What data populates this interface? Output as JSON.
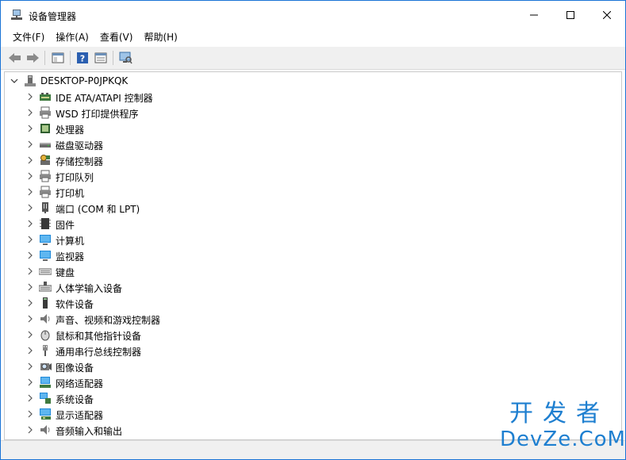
{
  "window": {
    "title": "设备管理器"
  },
  "menu": [
    {
      "label": "文件(F)"
    },
    {
      "label": "操作(A)"
    },
    {
      "label": "查看(V)"
    },
    {
      "label": "帮助(H)"
    }
  ],
  "tree": {
    "root": {
      "label": "DESKTOP-P0JPKQK",
      "icon": "computer-icon",
      "expanded": true
    },
    "items": [
      {
        "label": "IDE ATA/ATAPI 控制器",
        "icon": "ide-controller-icon"
      },
      {
        "label": "WSD 打印提供程序",
        "icon": "printer-icon"
      },
      {
        "label": "处理器",
        "icon": "processor-icon"
      },
      {
        "label": "磁盘驱动器",
        "icon": "disk-drive-icon"
      },
      {
        "label": "存储控制器",
        "icon": "storage-controller-icon"
      },
      {
        "label": "打印队列",
        "icon": "print-queue-icon"
      },
      {
        "label": "打印机",
        "icon": "printer-icon"
      },
      {
        "label": "端口 (COM 和 LPT)",
        "icon": "port-icon"
      },
      {
        "label": "固件",
        "icon": "firmware-icon"
      },
      {
        "label": "计算机",
        "icon": "monitor-icon"
      },
      {
        "label": "监视器",
        "icon": "monitor-icon"
      },
      {
        "label": "键盘",
        "icon": "keyboard-icon"
      },
      {
        "label": "人体学输入设备",
        "icon": "hid-icon"
      },
      {
        "label": "软件设备",
        "icon": "software-device-icon"
      },
      {
        "label": "声音、视频和游戏控制器",
        "icon": "speaker-icon"
      },
      {
        "label": "鼠标和其他指针设备",
        "icon": "mouse-icon"
      },
      {
        "label": "通用串行总线控制器",
        "icon": "usb-icon"
      },
      {
        "label": "图像设备",
        "icon": "camera-icon"
      },
      {
        "label": "网络适配器",
        "icon": "network-adapter-icon"
      },
      {
        "label": "系统设备",
        "icon": "system-device-icon"
      },
      {
        "label": "显示适配器",
        "icon": "display-adapter-icon"
      },
      {
        "label": "音频输入和输出",
        "icon": "audio-icon"
      }
    ]
  },
  "watermark": {
    "line1": "开发者",
    "line2": "DevZe.CoM"
  },
  "colors": {
    "accent": "#0a64c8",
    "watermark": "#1e7fd0"
  }
}
